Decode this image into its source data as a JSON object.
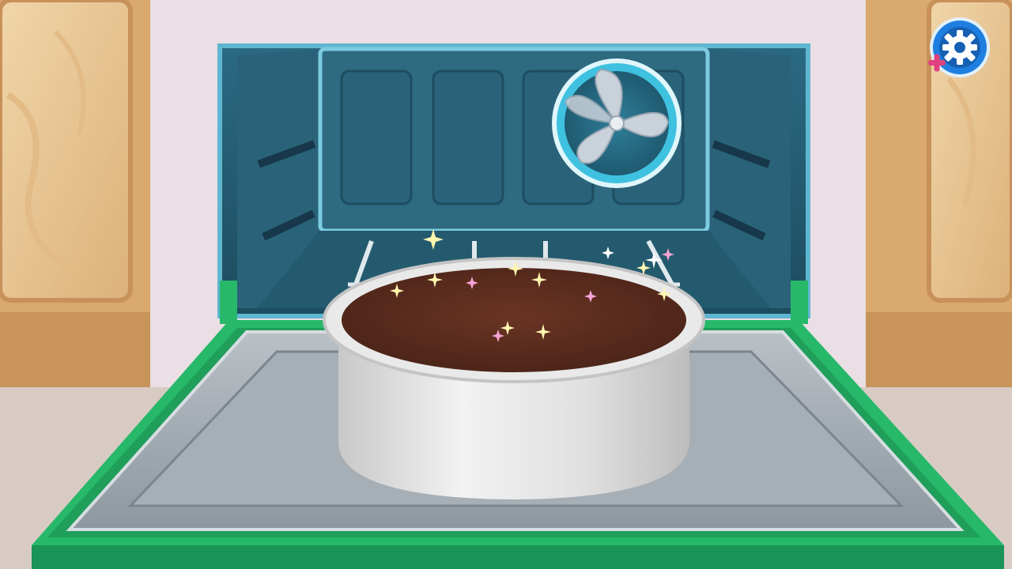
{
  "scene": {
    "name": "oven-baking-scene",
    "background": "#e9dfe4",
    "colors": {
      "oven_interior": "#2f6f86",
      "oven_interior_dark": "#1f4f62",
      "oven_trim": "#5fb6d1",
      "oven_door_frame": "#27b86a",
      "oven_door_dark": "#168a4c",
      "tray_metal": "#9aa3ab",
      "cake_pan": "#dcdcdc",
      "cake_top": "#5a2b1f",
      "cabinet_wood": "#e6c28f",
      "fan_ring": "#3fc1e0"
    },
    "icons": {
      "fan": "oven-fan-icon",
      "sparkle": "sparkle-icon",
      "settings": "gear-plus-icon"
    }
  },
  "settings": {
    "colors": {
      "ring": "#1e7fe0",
      "ring_dark": "#1560b3",
      "plus": "#e0427f",
      "gear": "#ffffff"
    }
  }
}
